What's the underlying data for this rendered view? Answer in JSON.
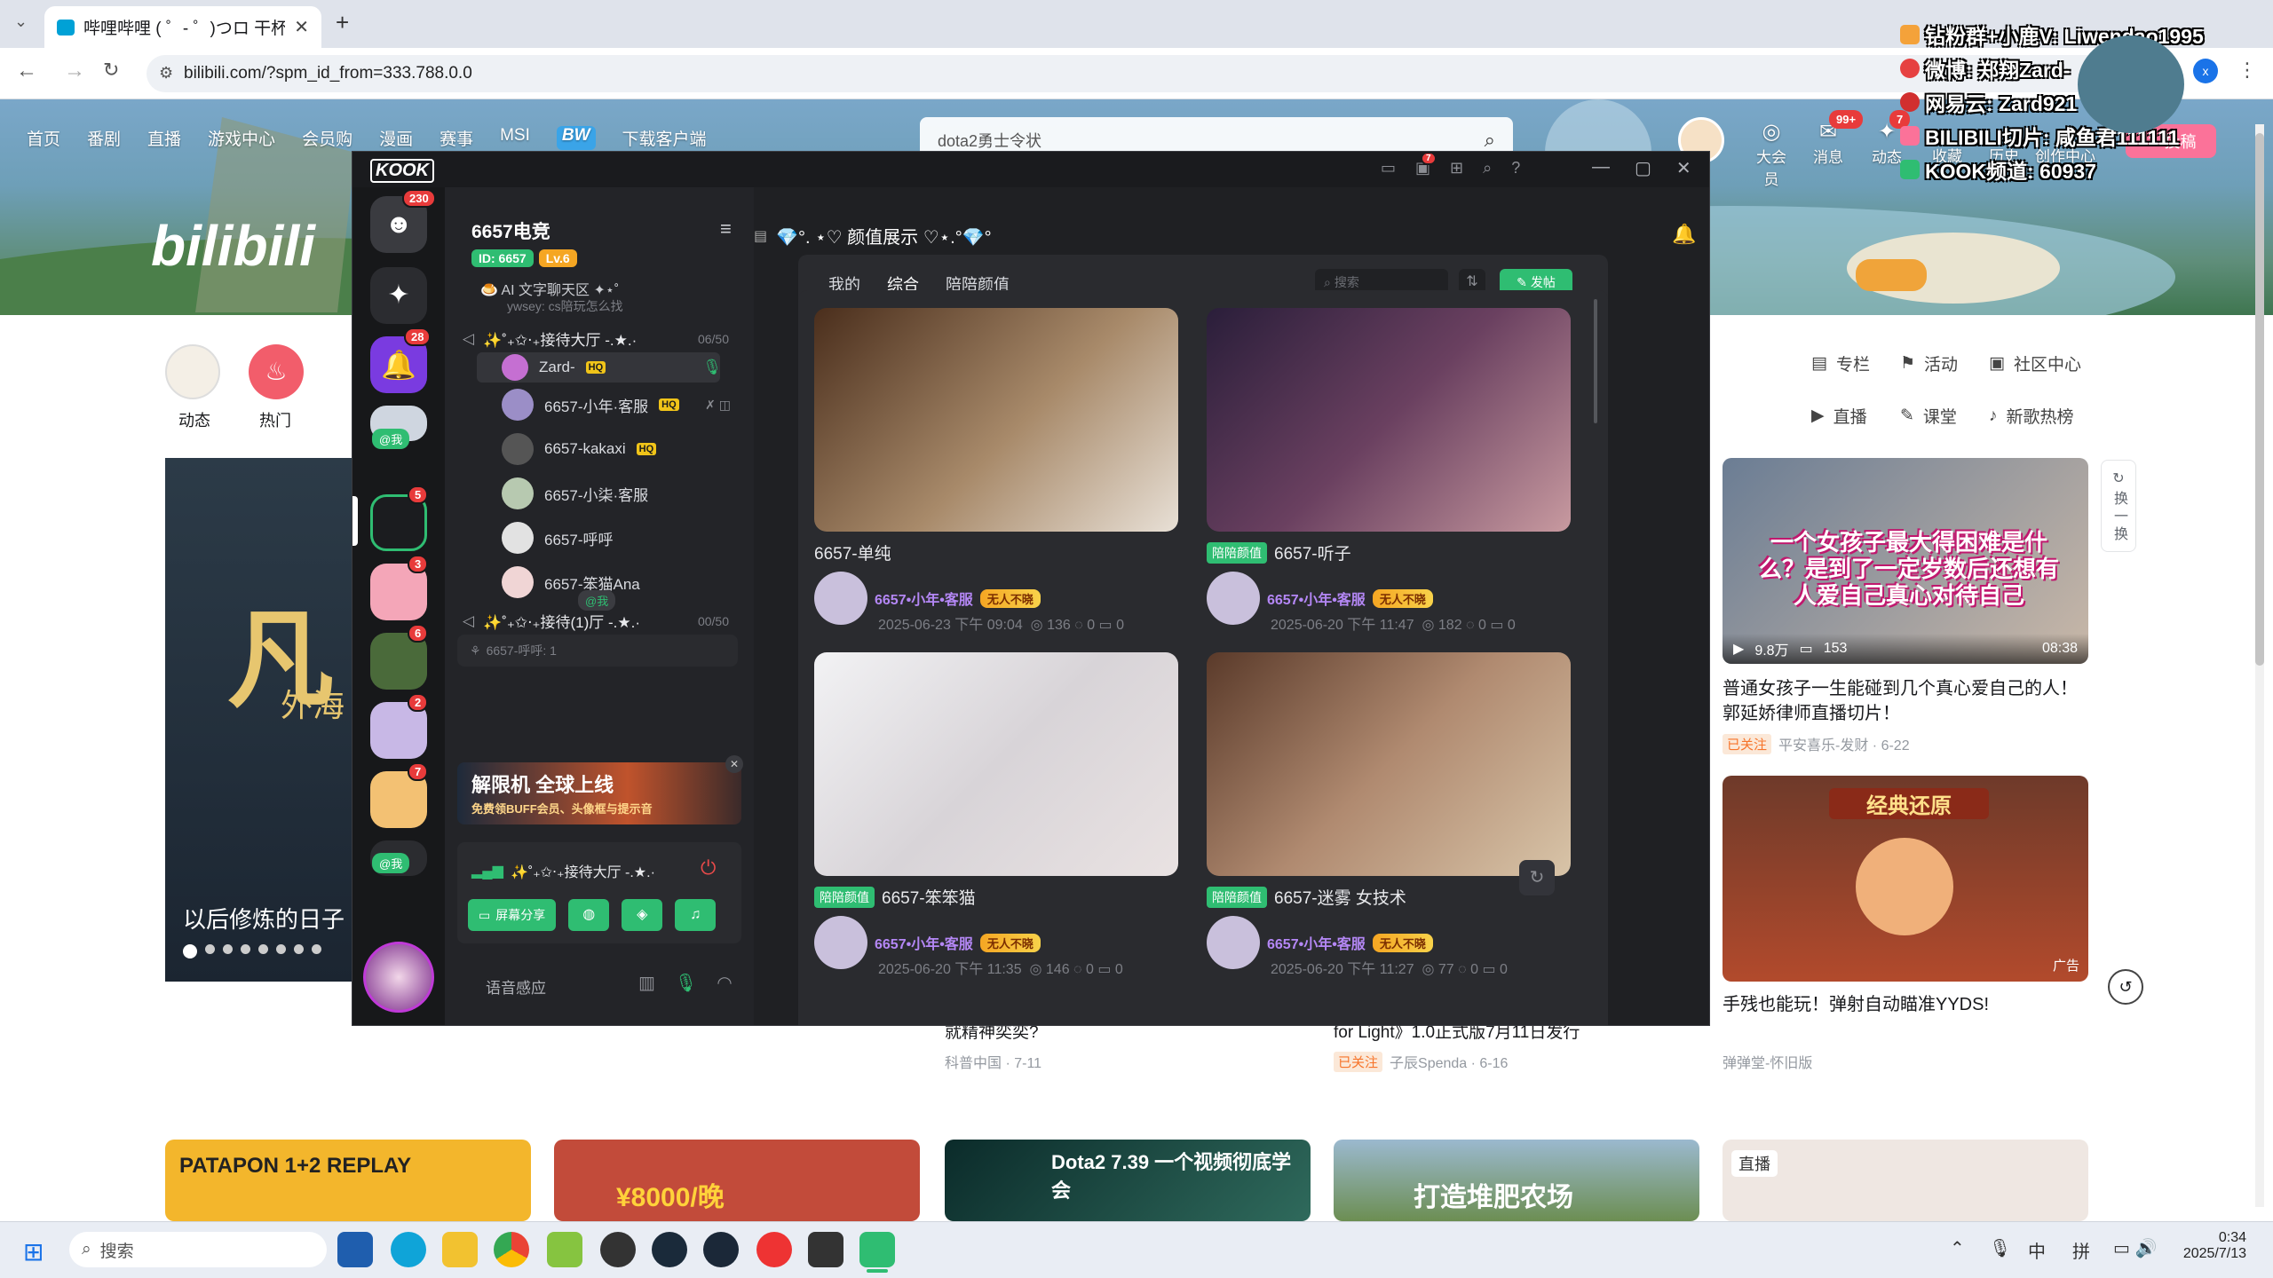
{
  "browser": {
    "tab_title": "哔哩哔哩 ( ゜- ゜)つロ 干杯~-b",
    "url": "bilibili.com/?spm_id_from=333.788.0.0"
  },
  "bili": {
    "nav": [
      "首页",
      "番剧",
      "直播",
      "游戏中心",
      "会员购",
      "漫画",
      "赛事",
      "MSI",
      "BW",
      "下载客户端"
    ],
    "logo": "bilibili",
    "search_value": "dota2勇士令状",
    "top_right": [
      "大会员",
      "消息",
      "动态",
      "收藏",
      "历史",
      "创作中心"
    ],
    "msg_badge": "99+",
    "dyn_badge": "7",
    "upload": "投稿",
    "quick_left": [
      "动态",
      "热门"
    ],
    "right_links": [
      "专栏",
      "活动",
      "社区中心",
      "直播",
      "课堂",
      "新歌热榜"
    ],
    "refresh": "换一换",
    "card1": {
      "views": "9.8万",
      "danmaku": "153",
      "duration": "08:38",
      "title": "普通女孩子一生能碰到几个真心爱自己的人！郭延娇律师直播切片！",
      "tag": "已关注",
      "author": "平安喜乐-发财 · 6-22",
      "thumb_text": "一个女孩子最大得困难是什么？是到了一定岁数后还想有人爱自己真心对待自己"
    },
    "card2": {
      "title": "手残也能玩！弹射自动瞄准YYDS!",
      "author": "弹弹堂-怀旧版",
      "ad": "广告",
      "thumb_text": "经典还原"
    },
    "hero_caption": "以后修炼的日子",
    "hero_text": "凡",
    "hero_sub": "外海",
    "below1": {
      "title": "就精神奕奕?",
      "meta": "科普中国 · 7-11"
    },
    "below2": {
      "title": "for Light》1.0正式版7月11日发行",
      "tag": "已关注",
      "meta": "子辰Spenda · 6-16"
    },
    "bottom_thumbs": [
      "PATAPON 1+2 REPLAY",
      "¥8000/晚",
      "Dota2 7.39 一个视频彻底学会",
      "打造堆肥农场",
      "直播"
    ]
  },
  "overlay": {
    "lines": [
      "钻粉群+小鹿V: Liwendao1995",
      "微博: 郑翔Zard-",
      "网易云: Zard921",
      "BILIBILI切片: 咸鱼君111111",
      "KOOK频道: 60937"
    ]
  },
  "kook": {
    "logo": "KOOK",
    "server_name": "6657电竞",
    "server_id": "ID: 6657",
    "server_level": "Lv.6",
    "dm_badge": "230",
    "rail_badges": [
      "28",
      "5",
      "3",
      "6",
      "2",
      "7"
    ],
    "at_me": "@我",
    "scrolled_top_channel": "🍮 AI 文字聊天区 ✦⋆˚",
    "scrolled_top_sub": "ywsey: cs陪玩怎么找",
    "channel_1": "✨˚₊✩‧₊接待大厅 -.★.·",
    "channel_1_count": "06/50",
    "members": [
      "Zard-",
      "6657-小年·客服",
      "6657-kakaxi",
      "6657-小柒·客服",
      "6657-呼呼",
      "6657-笨猫Ana"
    ],
    "channel_2": "✨˚₊✩‧₊接待(1)厅 -.★.·",
    "channel_2_count": "00/50",
    "input_hint": "6657-呼呼: 1",
    "ad_title": "解限机 全球上线",
    "ad_sub": "免费领BUFF会员、头像框与提示音",
    "voice_channel": "✨˚₊✩‧₊接待大厅 -.★.·",
    "screen_share": "屏幕分享",
    "voice_mode": "语音感应",
    "channel_title": "💎°. ⋆♡ 颜值展示 ♡⋆.°💎°",
    "tabs": [
      "我的",
      "综合",
      "陪陪颜值"
    ],
    "search_placeholder": "搜索",
    "post_button": "发帖",
    "posts": [
      {
        "name": "6657-单纯",
        "badge": "",
        "author": "6657•小年•客服",
        "level": "无人不晓",
        "date": "2025-06-23 下午 09:04",
        "views": "136",
        "likes": "0",
        "comments": "0"
      },
      {
        "name": "6657-听子",
        "badge": "陪陪颜值",
        "author": "6657•小年•客服",
        "level": "无人不晓",
        "date": "2025-06-20 下午 11:47",
        "views": "182",
        "likes": "0",
        "comments": "0"
      },
      {
        "name": "6657-笨笨猫",
        "badge": "陪陪颜值",
        "author": "6657•小年•客服",
        "level": "无人不晓",
        "date": "2025-06-20 下午 11:35",
        "views": "146",
        "likes": "0",
        "comments": "0"
      },
      {
        "name": "6657-迷雾 女技术",
        "badge": "陪陪颜值",
        "author": "6657•小年•客服",
        "level": "无人不晓",
        "date": "2025-06-20 下午 11:27",
        "views": "77",
        "likes": "0",
        "comments": "0"
      }
    ]
  },
  "taskbar": {
    "search": "搜索",
    "ime": [
      "中",
      "拼"
    ],
    "time": "0:34",
    "date": "2025/7/13"
  },
  "colors": {
    "kook_green": "#2fbd72",
    "bili_pink": "#fb7299",
    "kook_bg": "#1f2023"
  }
}
